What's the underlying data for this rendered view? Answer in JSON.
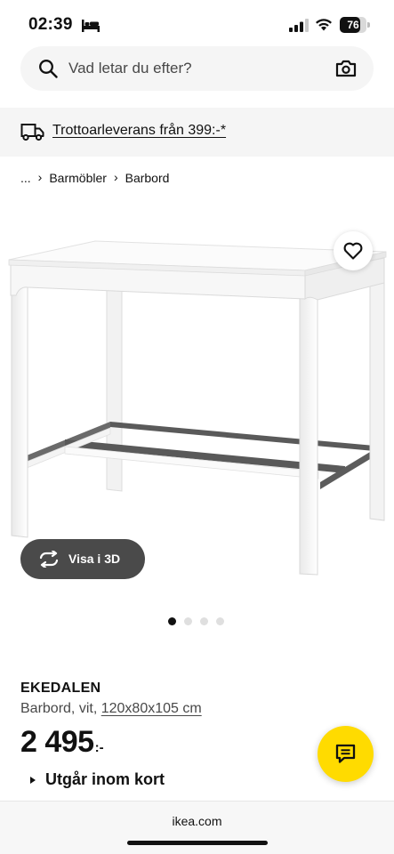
{
  "status_bar": {
    "time": "02:39",
    "battery": "76",
    "battery_level": 0.76
  },
  "search": {
    "placeholder": "Vad letar du efter?",
    "icon": "search-icon",
    "camera_icon": "camera-icon"
  },
  "delivery": {
    "text": "Trottoarleverans från 399:-*",
    "icon": "truck-icon"
  },
  "breadcrumb": {
    "ellipsis": "...",
    "items": [
      "Barmöbler",
      "Barbord"
    ]
  },
  "gallery": {
    "view_3d_label": "Visa i 3D",
    "slide_count": 4,
    "active_slide": 1
  },
  "product": {
    "name": "EKEDALEN",
    "description": "Barbord, vit,",
    "dimensions": "120x80x105 cm",
    "price": "2 495",
    "price_suffix": ":-",
    "availability": "Utgår inom kort"
  },
  "browser": {
    "url": "ikea.com"
  },
  "colors": {
    "accent_yellow": "#ffdb00",
    "dark_button": "#4a4a4a",
    "light_background": "#f5f5f5"
  }
}
